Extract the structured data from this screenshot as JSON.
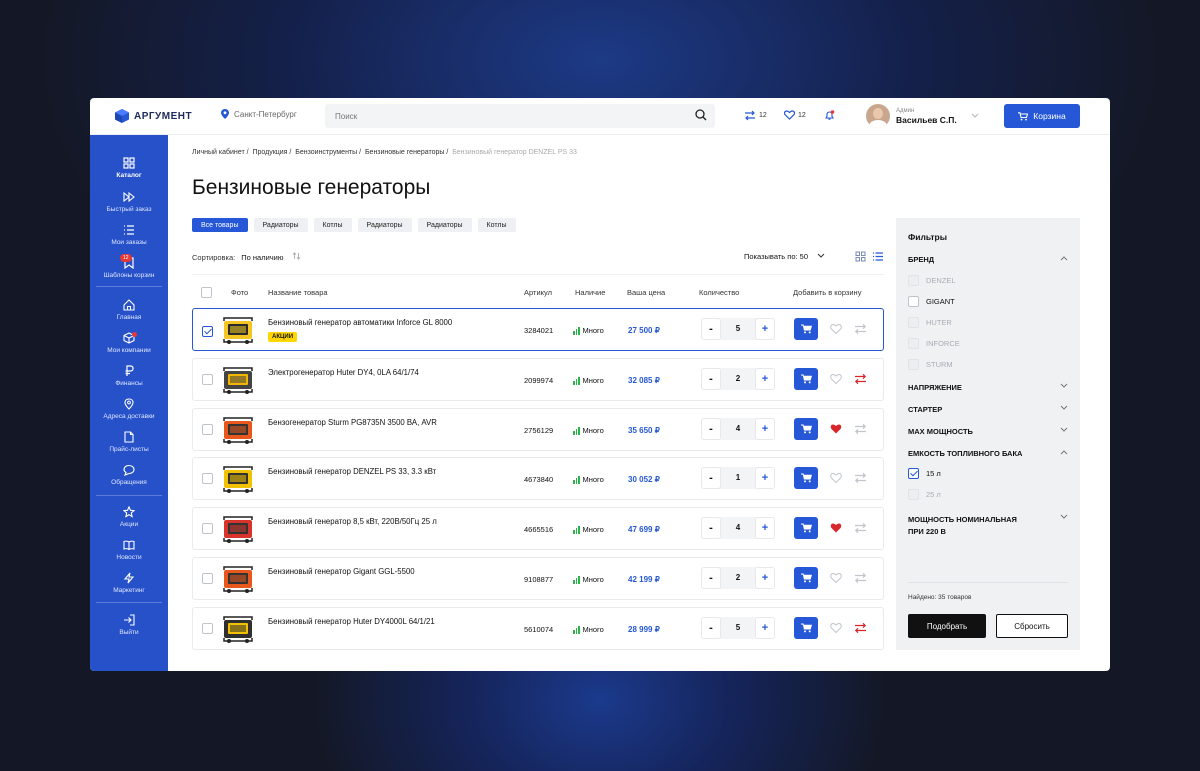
{
  "brand": {
    "logo_text": "АРГУМЕНТ",
    "accent": "#2557d6",
    "sidebar_color": "#2651c9"
  },
  "topbar": {
    "city": "Санкт-Петербург",
    "search_placeholder": "Поиск",
    "compare_count": "12",
    "favorites_count": "12",
    "user_role": "Админ",
    "user_name": "Васильев С.П.",
    "cart_label": "Корзина"
  },
  "sidebar": {
    "items": [
      {
        "label": "Каталог",
        "icon": "grid-icon"
      },
      {
        "label": "Быстрый заказ",
        "icon": "fast-forward-icon"
      },
      {
        "label": "Мои заказы",
        "icon": "list-icon"
      },
      {
        "label": "Шаблоны корзин",
        "icon": "bookmark-icon",
        "badge": "12"
      },
      {
        "label": "Главная",
        "icon": "home-icon"
      },
      {
        "label": "Мои компании",
        "icon": "box-icon"
      },
      {
        "label": "Финансы",
        "icon": "ruble-icon"
      },
      {
        "label": "Адреса доставки",
        "icon": "location-icon"
      },
      {
        "label": "Прайс-листы",
        "icon": "document-icon"
      },
      {
        "label": "Обращения",
        "icon": "chat-icon"
      },
      {
        "label": "Акции",
        "icon": "star-icon"
      },
      {
        "label": "Новости",
        "icon": "book-icon"
      },
      {
        "label": "Маркетинг",
        "icon": "lightning-icon"
      },
      {
        "label": "Выйти",
        "icon": "logout-icon"
      }
    ]
  },
  "breadcrumbs": [
    "Личный кабинет",
    "Продукция",
    "Бензоинструменты",
    "Бензиновые генераторы",
    "Бензиновый генератор DENZEL PS 33"
  ],
  "page_title": "Бензиновые генераторы",
  "chips": [
    "Все товары",
    "Радиаторы",
    "Котлы",
    "Радиаторы",
    "Радиаторы",
    "Котлы"
  ],
  "sort": {
    "label": "Сортировка:",
    "value": "По наличию"
  },
  "show": {
    "label": "Показывать по:",
    "value": "50"
  },
  "table": {
    "headers": [
      "Фото",
      "Название товара",
      "Артикул",
      "Наличие",
      "Ваша цена",
      "Количество",
      "Добавить в корзину"
    ],
    "rows": [
      {
        "name": "Бензиновый генератор автоматики Inforce GL 8000",
        "promo": "АКЦИИ",
        "sku": "3284021",
        "stock": "Много",
        "price": "27 500 ₽",
        "qty": "5",
        "checked": true,
        "fav": "outline",
        "compare": "grey"
      },
      {
        "name": "Электрогенератор Huter DY4, 0LA 64/1/74",
        "sku": "2099974",
        "stock": "Много",
        "price": "32 085 ₽",
        "qty": "2",
        "fav": "outline",
        "compare": "red"
      },
      {
        "name": "Бензогенератор Sturm PG8735N 3500 ВА, AVR",
        "sku": "2756129",
        "stock": "Много",
        "price": "35 650 ₽",
        "qty": "4",
        "fav": "filled",
        "compare": "grey"
      },
      {
        "name": "Бензиновый генератор DENZEL PS 33, 3.3 кВт",
        "sku": "4673840",
        "stock": "Много",
        "price": "30 052 ₽",
        "qty": "1",
        "fav": "outline",
        "compare": "grey"
      },
      {
        "name": "Бензиновый генератор 8,5 кВт, 220В/50Гц 25 л",
        "sku": "4665516",
        "stock": "Много",
        "price": "47 699 ₽",
        "qty": "4",
        "fav": "filled",
        "compare": "grey"
      },
      {
        "name": "Бензиновый генератор Gigant GGL-5500",
        "sku": "9108877",
        "stock": "Много",
        "price": "42 199 ₽",
        "qty": "2",
        "fav": "outline",
        "compare": "grey"
      },
      {
        "name": "Бензиновый генератор Huter DY4000L 64/1/21",
        "sku": "5610074",
        "stock": "Много",
        "price": "28 999 ₽",
        "qty": "5",
        "fav": "outline",
        "compare": "red"
      }
    ]
  },
  "filters": {
    "title": "Фильтры",
    "brand_title": "БРЕНД",
    "brands": [
      {
        "label": "DENZEL",
        "disabled": true
      },
      {
        "label": "GIGANT",
        "disabled": false
      },
      {
        "label": "HUTER",
        "disabled": true
      },
      {
        "label": "INFORCE",
        "disabled": true
      },
      {
        "label": "STURM",
        "disabled": true
      }
    ],
    "sections": [
      "НАПРЯЖЕНИЕ",
      "СТАРТЕР",
      "MAX МОЩНОСТЬ",
      "ЕМКОСТЬ ТОПЛИВНОГО БАКА"
    ],
    "tank_options": [
      {
        "label": "15 л",
        "checked": true
      },
      {
        "label": "25 л",
        "disabled": true
      }
    ],
    "power_title_1": "МОЩНОСТЬ НОМИНАЛЬНАЯ",
    "power_title_2": "ПРИ 220 В",
    "found": "Найдено: 35 товаров",
    "apply": "Подобрать",
    "reset": "Сбросить"
  }
}
